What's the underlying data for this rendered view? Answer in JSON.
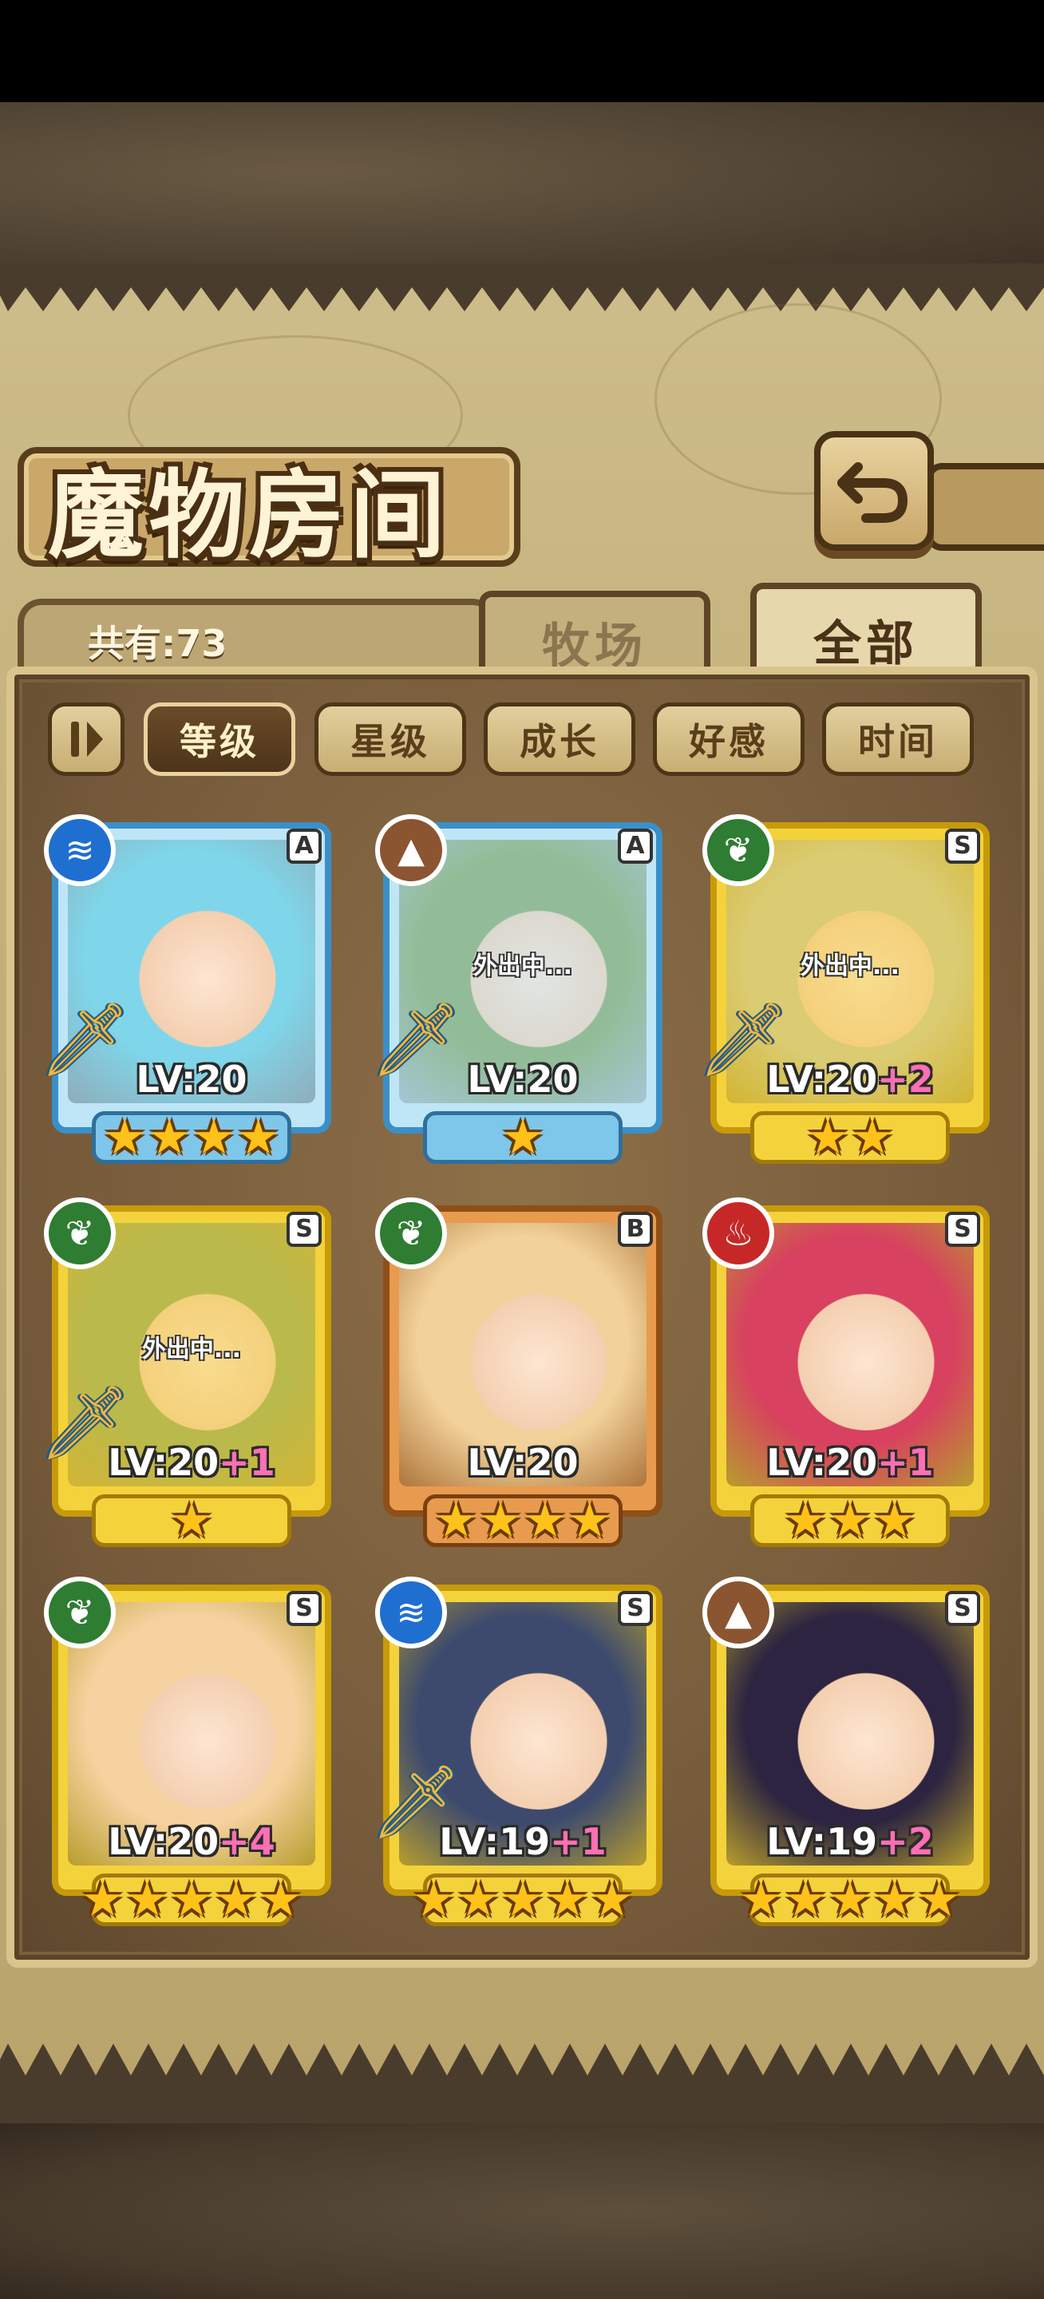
{
  "header": {
    "title": "魔物房间",
    "count_label": "共有:73",
    "back_icon": "back-arrow-icon"
  },
  "tabs": [
    {
      "label": "牧场",
      "selected": false
    },
    {
      "label": "全部",
      "selected": true
    }
  ],
  "sort": {
    "toggle_icon": "pause-toggle-icon",
    "options": [
      {
        "label": "等级",
        "active": true
      },
      {
        "label": "星级",
        "active": false
      },
      {
        "label": "成长",
        "active": false
      },
      {
        "label": "好感",
        "active": false
      },
      {
        "label": "时间",
        "active": false
      }
    ]
  },
  "cards": [
    {
      "element": "water",
      "element_color": "#1f6fd1",
      "rarity": "A",
      "frame": "blue",
      "level": "LV:20",
      "bonus": "",
      "stars": 4,
      "away": "",
      "sword": true,
      "art_color": "#7fd6ea"
    },
    {
      "element": "earth",
      "element_color": "#8a5530",
      "rarity": "A",
      "frame": "blue",
      "level": "LV:20",
      "bonus": "",
      "stars": 1,
      "away": "外出中...",
      "sword": true,
      "art_color": "#6f9a4a"
    },
    {
      "element": "nature",
      "element_color": "#2e7d32",
      "rarity": "S",
      "frame": "gold",
      "level": "LV:20",
      "bonus": "+2",
      "stars": 2,
      "away": "外出中...",
      "sword": true,
      "art_color": "#c7c7a0"
    },
    {
      "element": "nature",
      "element_color": "#2e7d32",
      "rarity": "S",
      "frame": "gold",
      "level": "LV:20",
      "bonus": "+1",
      "stars": 1,
      "away": "外出中...",
      "sword": true,
      "art_color": "#8aa65a"
    },
    {
      "element": "nature",
      "element_color": "#2e7d32",
      "rarity": "B",
      "frame": "bronze",
      "level": "LV:20",
      "bonus": "",
      "stars": 4,
      "away": "",
      "sword": false,
      "art_color": "#f2d29a"
    },
    {
      "element": "fire",
      "element_color": "#c62828",
      "rarity": "S",
      "frame": "gold",
      "level": "LV:20",
      "bonus": "+1",
      "stars": 3,
      "away": "",
      "sword": false,
      "art_color": "#d8415f"
    },
    {
      "element": "nature",
      "element_color": "#2e7d32",
      "rarity": "S",
      "frame": "gold",
      "level": "LV:20",
      "bonus": "+4",
      "stars": 5,
      "away": "",
      "sword": false,
      "art_color": "#f6d2a0"
    },
    {
      "element": "water",
      "element_color": "#1f6fd1",
      "rarity": "S",
      "frame": "gold",
      "level": "LV:19",
      "bonus": "+1",
      "stars": 5,
      "away": "",
      "sword": true,
      "art_color": "#3d4a6e"
    },
    {
      "element": "earth",
      "element_color": "#8a5530",
      "rarity": "S",
      "frame": "gold",
      "level": "LV:19",
      "bonus": "+2",
      "stars": 5,
      "away": "",
      "sword": false,
      "art_color": "#2c2440"
    }
  ]
}
